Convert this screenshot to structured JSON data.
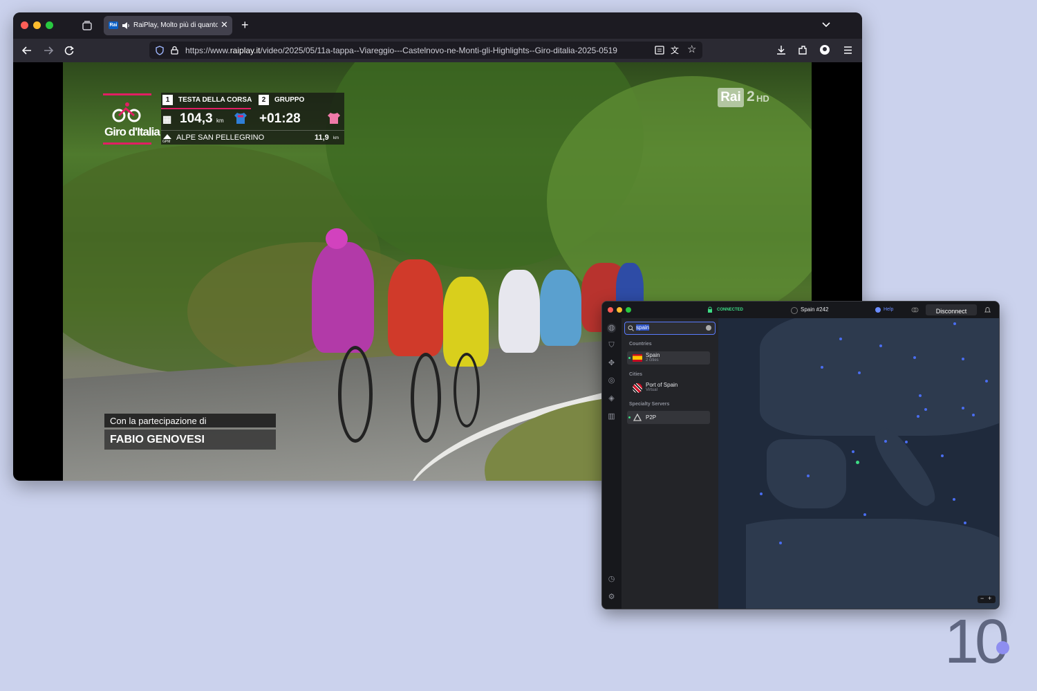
{
  "browser": {
    "tab_title": "RaiPlay, Molto più di quanto",
    "tab_badge": "Rai",
    "url_prefix": "https://www.",
    "url_domain": "raiplay.it",
    "url_path": "/video/2025/05/11a-tappa--Viareggio---Castelnovo-ne-Monti-gli-Highlights--Giro-ditalia-2025-0519"
  },
  "video_overlay": {
    "logo_text": "Giro d'Italia",
    "channel": "Rai",
    "channel_suffix": "2",
    "channel_hd": "HD",
    "lead": {
      "position": "1",
      "label": "TESTA DELLA CORSA",
      "distance": "104,3",
      "unit": "km"
    },
    "group": {
      "position": "2",
      "label": "GRUPPO",
      "gap": "+01:28"
    },
    "climb": {
      "icon_label": "GPM",
      "name": "ALPE SAN PELLEGRINO",
      "distance": "11,9",
      "unit": "km"
    },
    "credits": {
      "line1": "Con la partecipazione di",
      "line2": "FABIO GENOVESI"
    }
  },
  "vpn": {
    "status": "CONNECTED",
    "server": "Spain #242",
    "help": "Help",
    "disconnect": "Disconnect",
    "search_value": "spain",
    "sections": {
      "countries": "Countries",
      "cities": "Cities",
      "specialty": "Specialty Servers"
    },
    "country": {
      "name": "Spain",
      "sub": "2 cities"
    },
    "city": {
      "name": "Port of Spain",
      "sub": "Virtual"
    },
    "specialty": {
      "name": "P2P"
    },
    "zoom_out": "−",
    "zoom_in": "+"
  },
  "watermark": "10",
  "colors": {
    "accent_green": "#3ddc84",
    "map_dot": "#4a6df0",
    "help_blue": "#6b8cff"
  }
}
